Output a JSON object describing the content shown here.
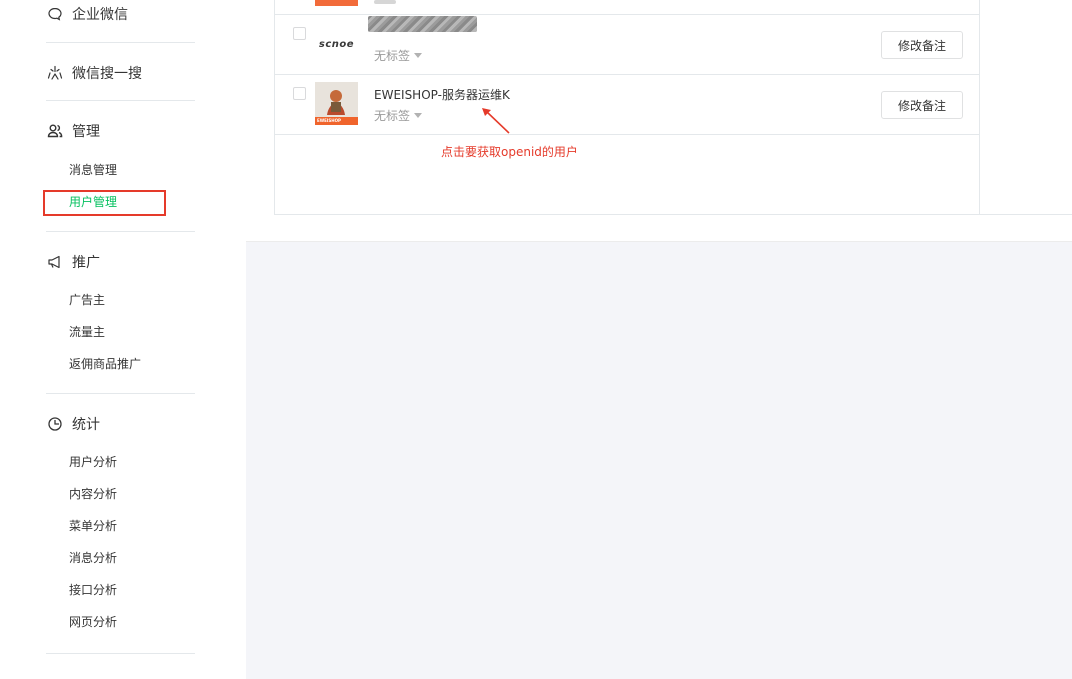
{
  "sidebar": {
    "sections": [
      {
        "id": "wecom",
        "label": "企业微信",
        "icon": "chat-bubble-icon"
      },
      {
        "id": "search",
        "label": "微信搜一搜",
        "icon": "search-sparkle-icon"
      },
      {
        "id": "manage",
        "label": "管理",
        "icon": "users-icon",
        "items": [
          "消息管理",
          "用户管理"
        ]
      },
      {
        "id": "promote",
        "label": "推广",
        "icon": "megaphone-icon",
        "items": [
          "广告主",
          "流量主",
          "返佣商品推广"
        ]
      },
      {
        "id": "stats",
        "label": "统计",
        "icon": "clock-chart-icon",
        "items": [
          "用户分析",
          "内容分析",
          "菜单分析",
          "消息分析",
          "接口分析",
          "网页分析"
        ]
      }
    ],
    "active_item": "用户管理",
    "accent": "#07c160",
    "highlight_color": "#e53a2a"
  },
  "users": [
    {
      "name": "",
      "name_redacted": true,
      "avatar": "scnoe-logo",
      "avatar_text": "scnoe",
      "tag": "无标签",
      "button": "修改备注"
    },
    {
      "name": "EWEISHOP-服务器运维K",
      "avatar": "eweishop-avatar",
      "avatar_text": "EWEISHOP",
      "tag": "无标签",
      "button": "修改备注"
    }
  ],
  "annotation": "点击要获取openid的用户"
}
